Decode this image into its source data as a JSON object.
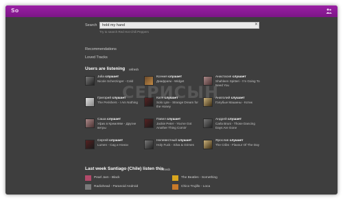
{
  "topbar": {
    "logo_text": "So",
    "accent": "#8a1a95"
  },
  "search": {
    "label": "Search",
    "value": "hold my hand",
    "clear": "✕",
    "hint": "Try to search Red Hot Chili Peppers"
  },
  "nav": {
    "recommendations": "Recommendations",
    "loved_tracks": "Loved Tracks"
  },
  "listening": {
    "title": "Users are listening",
    "refresh": "refresh"
  },
  "users": [
    {
      "name": "Julia",
      "verb": "слушает",
      "track": "Nicole Scherzinger - Cold"
    },
    {
      "name": "Ксения",
      "verb": "слушает",
      "track": "Диафрагм - Widget"
    },
    {
      "name": "Анастасия",
      "verb": "слушает",
      "track": "Shahleen Spitteri - I'm Going To Need You"
    },
    {
      "name": "Григорий",
      "verb": "слушает",
      "track": "The Perishers - I Am Nothing"
    },
    {
      "name": "Катя",
      "verb": "слушает",
      "track": "Solo Lyte - Strange Dream for the Honey"
    },
    {
      "name": "Анатолий",
      "verb": "слушает",
      "track": "Голубые Машины - Котик"
    },
    {
      "name": "Саша",
      "verb": "слушает",
      "track": "Уфиз в Кремлёве - Другие ветры"
    },
    {
      "name": "Павел",
      "verb": "слушает",
      "track": "Jackie Peter - You've Got Another Thing Comin'"
    },
    {
      "name": "Андрей",
      "verb": "слушает",
      "track": "Carla Bruni - Those Dancing Days Are Gone"
    },
    {
      "name": "Сергей",
      "verb": "слушает",
      "track": "Lumen - Сид и Нэнси"
    },
    {
      "name": "Нелевестный",
      "verb": "слушает",
      "track": "Holy Fuck - Silva & Grimes"
    },
    {
      "name": "Ярослав",
      "verb": "слушает",
      "track": "The Cribs - Flavour Of The Day"
    }
  ],
  "watermark": "СЕРИСЫН",
  "local": {
    "title": "Last week Santiago (Chile) listen this",
    "refresh": "refresh",
    "items": [
      {
        "text": "Pearl Jam - Black",
        "color": "#b24a6a"
      },
      {
        "text": "The Beatles - Something",
        "color": "#d9a61e"
      },
      {
        "text": "Radiohead - Paranoid Android",
        "color": "#7a7a7a"
      },
      {
        "text": "Chico Trujillo - Loca",
        "color": "#c87a2a"
      }
    ]
  }
}
